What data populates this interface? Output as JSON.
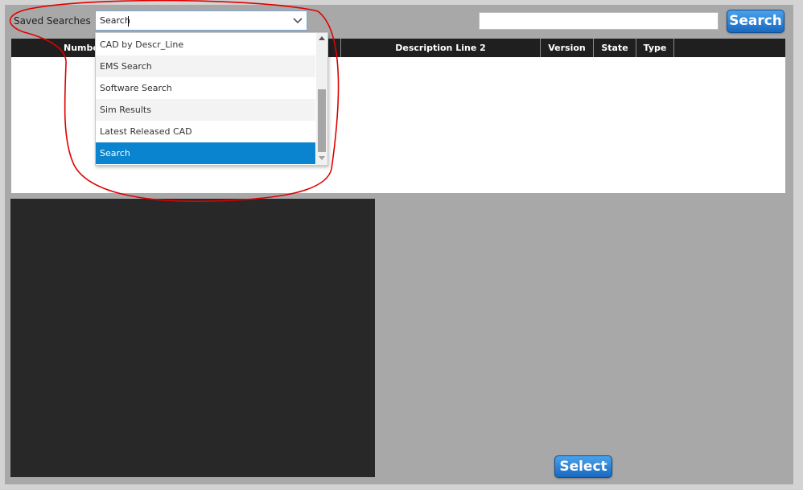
{
  "saved_searches": {
    "label": "Saved Searches",
    "value": "Search",
    "options": [
      {
        "label": "CAD by Descr_Line",
        "selected": false
      },
      {
        "label": "EMS Search",
        "selected": false
      },
      {
        "label": "Software Search",
        "selected": false
      },
      {
        "label": "Sim Results",
        "selected": false
      },
      {
        "label": "Latest Released CAD",
        "selected": false
      },
      {
        "label": "Search",
        "selected": true
      }
    ]
  },
  "search": {
    "value": "",
    "button_label": "Search"
  },
  "table": {
    "columns": [
      "Number",
      "Description Line 2",
      "Version",
      "State",
      "Type"
    ]
  },
  "footer": {
    "select_label": "Select"
  },
  "colors": {
    "accent": "#1a6fc4",
    "selection": "#0a84ce",
    "annotation": "#e00000",
    "panel_bg": "#a8a8a8",
    "header_bg": "#1f1f1f"
  }
}
